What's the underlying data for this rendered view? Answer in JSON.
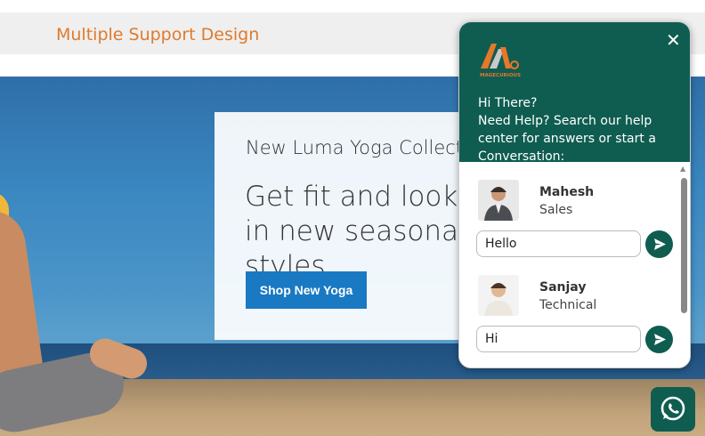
{
  "header": {
    "title": "Multiple Support Design"
  },
  "hero": {
    "subtitle": "New Luma Yoga Collection",
    "headline": "Get fit and look fab in new seasonal styles",
    "cta_label": "Shop New Yoga"
  },
  "chat_widget": {
    "brand_logo_text": "MAGECURIOUS",
    "close_icon": "close-icon",
    "greeting_line1": "Hi There?",
    "greeting_line2": "Need Help? Search our help center for answers or start a Conversation:",
    "agents": [
      {
        "name": "Mahesh",
        "role": "Sales",
        "message_value": "Hello"
      },
      {
        "name": "Sanjay",
        "role": "Technical",
        "message_value": "Hi"
      }
    ],
    "send_icon": "send-icon"
  },
  "floating_button": {
    "icon": "whatsapp-icon"
  },
  "colors": {
    "accent_orange": "#e07a2c",
    "widget_green": "#0f5d50",
    "cta_blue": "#1979c3"
  }
}
